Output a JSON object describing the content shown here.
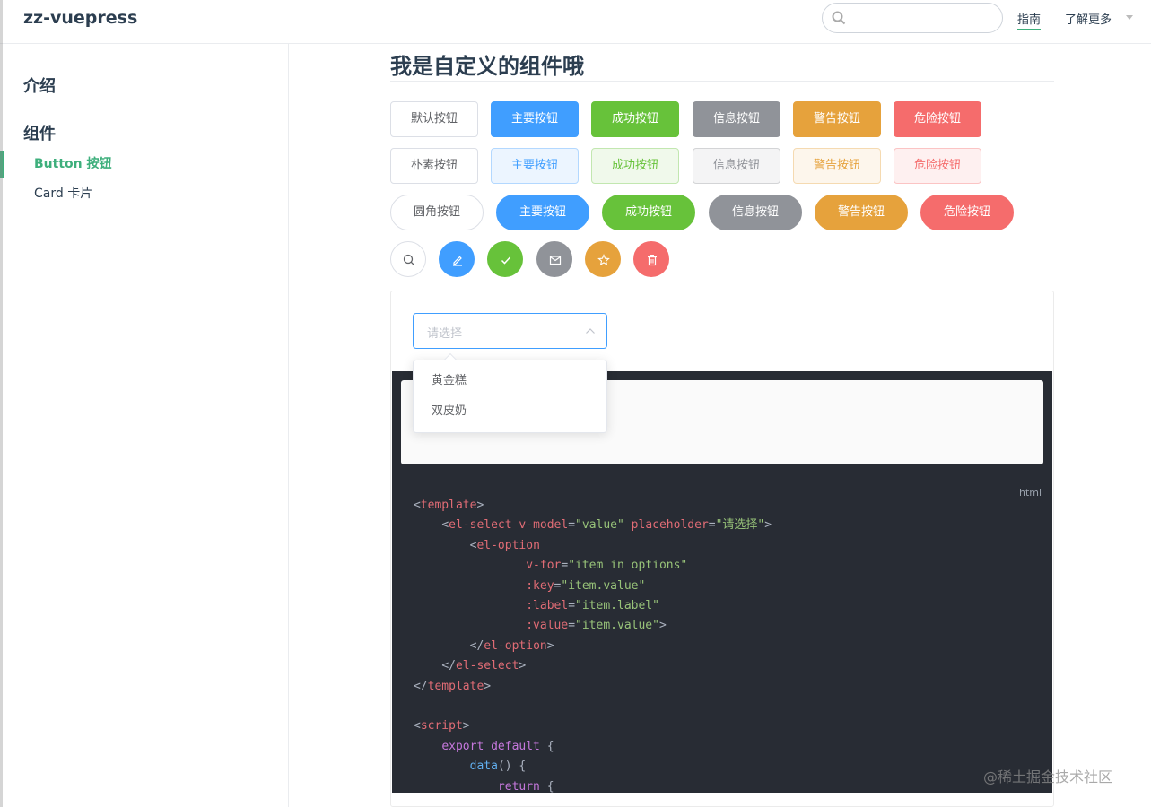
{
  "navbar": {
    "site_name": "zz-vuepress",
    "search_placeholder": "",
    "links": [
      {
        "label": "指南"
      },
      {
        "label": "了解更多"
      }
    ]
  },
  "sidebar": {
    "groups": [
      {
        "title": "介绍"
      },
      {
        "title": "组件",
        "items": [
          {
            "label": "Button 按钮",
            "active": true
          },
          {
            "label": "Card 卡片",
            "active": false
          }
        ]
      }
    ]
  },
  "page": {
    "title": "我是自定义的组件哦"
  },
  "buttons": {
    "row1": [
      "默认按钮",
      "主要按钮",
      "成功按钮",
      "信息按钮",
      "警告按钮",
      "危险按钮"
    ],
    "row2": [
      "朴素按钮",
      "主要按钮",
      "成功按钮",
      "信息按钮",
      "警告按钮",
      "危险按钮"
    ],
    "row3": [
      "圆角按钮",
      "主要按钮",
      "成功按钮",
      "信息按钮",
      "警告按钮",
      "危险按钮"
    ],
    "icons": [
      "search-icon",
      "edit-icon",
      "check-icon",
      "message-icon",
      "star-icon",
      "delete-icon"
    ]
  },
  "colors": {
    "primary": "#409eff",
    "success": "#67c23a",
    "info": "#909399",
    "warning": "#e6a23c",
    "danger": "#f56c6c",
    "accent": "#3eaf7c",
    "code_bg": "#282c34"
  },
  "select": {
    "placeholder": "请选择",
    "options": [
      "黄金糕",
      "双皮奶"
    ]
  },
  "code": {
    "language": "html",
    "lines": [
      "<template>",
      "    <el-select v-model=\"value\" placeholder=\"请选择\">",
      "        <el-option",
      "                v-for=\"item in options\"",
      "                :key=\"item.value\"",
      "                :label=\"item.label\"",
      "                :value=\"item.value\">",
      "        </el-option>",
      "    </el-select>",
      "</template>",
      "",
      "<script>",
      "    export default {",
      "        data() {",
      "            return {"
    ]
  },
  "watermark": "@稀土掘金技术社区"
}
